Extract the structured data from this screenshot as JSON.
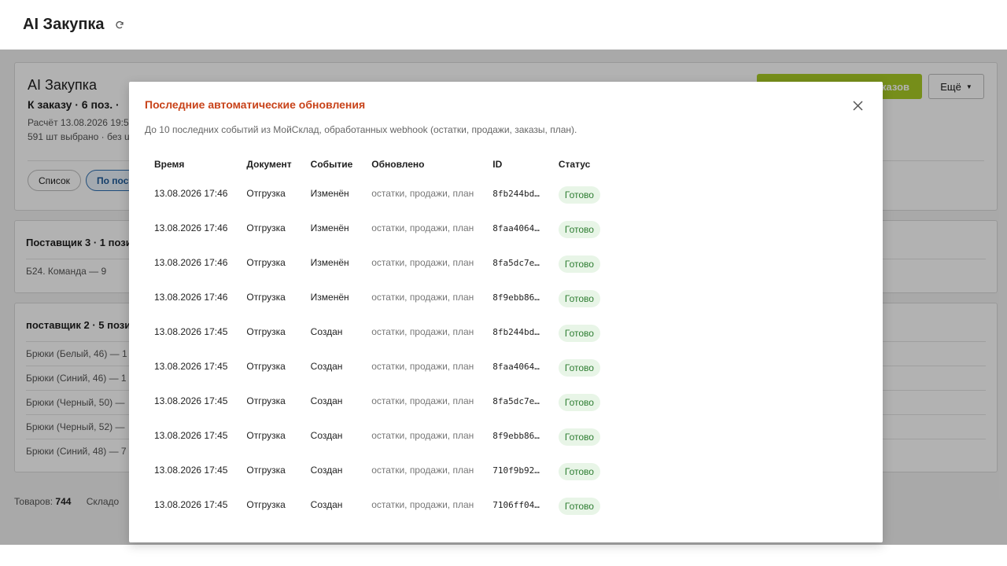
{
  "app": {
    "title": "AI Закупка"
  },
  "main": {
    "title": "AI Закупка",
    "subtitle": "К заказу · 6 поз. ·",
    "calc_line": "Расчёт 13.08.2026 19:5",
    "selected_line": "591 шт выбрано · без u",
    "view_list_label": "Список",
    "view_supplier_label": "По пост",
    "primary_button_label": "казов",
    "more_button_label": "Ещё"
  },
  "suppliers": [
    {
      "title": "Поставщик 3 · 1 пози",
      "items": [
        "Б24. Команда — 9"
      ]
    },
    {
      "title": "поставщик 2 · 5 пози",
      "items": [
        "Брюки (Белый, 46) — 1",
        "Брюки (Синий, 46) — 1",
        "Брюки (Черный, 50) —",
        "Брюки (Черный, 52) —",
        "Брюки (Синий, 48) — 7"
      ]
    }
  ],
  "footer": {
    "goods_label": "Товаров:",
    "goods_value": "744",
    "stock_label": "Складо"
  },
  "modal": {
    "title": "Последние автоматические обновления",
    "description": "До 10 последних событий из МойСклад, обработанных webhook (остатки, продажи, заказы, план).",
    "columns": [
      "Время",
      "Документ",
      "Событие",
      "Обновлено",
      "ID",
      "Статус"
    ],
    "rows": [
      {
        "time": "13.08.2026 17:46",
        "doc": "Отгрузка",
        "event": "Изменён",
        "updated": "остатки, продажи, план",
        "id": "8fb244bd…",
        "status": "Готово"
      },
      {
        "time": "13.08.2026 17:46",
        "doc": "Отгрузка",
        "event": "Изменён",
        "updated": "остатки, продажи, план",
        "id": "8faa4064…",
        "status": "Готово"
      },
      {
        "time": "13.08.2026 17:46",
        "doc": "Отгрузка",
        "event": "Изменён",
        "updated": "остатки, продажи, план",
        "id": "8fa5dc7e…",
        "status": "Готово"
      },
      {
        "time": "13.08.2026 17:46",
        "doc": "Отгрузка",
        "event": "Изменён",
        "updated": "остатки, продажи, план",
        "id": "8f9ebb86…",
        "status": "Готово"
      },
      {
        "time": "13.08.2026 17:45",
        "doc": "Отгрузка",
        "event": "Создан",
        "updated": "остатки, продажи, план",
        "id": "8fb244bd…",
        "status": "Готово"
      },
      {
        "time": "13.08.2026 17:45",
        "doc": "Отгрузка",
        "event": "Создан",
        "updated": "остатки, продажи, план",
        "id": "8faa4064…",
        "status": "Готово"
      },
      {
        "time": "13.08.2026 17:45",
        "doc": "Отгрузка",
        "event": "Создан",
        "updated": "остатки, продажи, план",
        "id": "8fa5dc7e…",
        "status": "Готово"
      },
      {
        "time": "13.08.2026 17:45",
        "doc": "Отгрузка",
        "event": "Создан",
        "updated": "остатки, продажи, план",
        "id": "8f9ebb86…",
        "status": "Готово"
      },
      {
        "time": "13.08.2026 17:45",
        "doc": "Отгрузка",
        "event": "Создан",
        "updated": "остатки, продажи, план",
        "id": "710f9b92…",
        "status": "Готово"
      },
      {
        "time": "13.08.2026 17:45",
        "doc": "Отгрузка",
        "event": "Создан",
        "updated": "остатки, продажи, план",
        "id": "7106ff04…",
        "status": "Готово"
      }
    ]
  },
  "colors": {
    "accent": "#c8431a",
    "primary_button": "#a9cc26",
    "status_bg": "#e8f5e7",
    "status_text": "#2e7d32"
  },
  "icons": {
    "refresh": "refresh-icon",
    "close": "close-icon",
    "caret": "caret-down-icon"
  }
}
